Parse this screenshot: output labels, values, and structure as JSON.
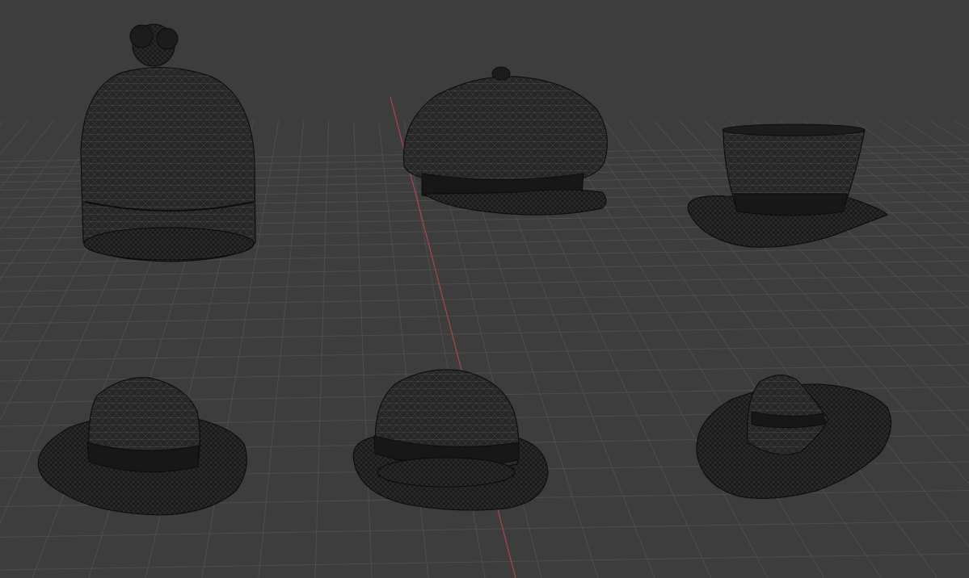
{
  "viewport": {
    "background": "#3d3d3d",
    "grid_color": "#4e4e4e",
    "x_axis_color": "#a9484e",
    "mesh_color": "#262626",
    "wire_color": "#4a4a4a",
    "shading": "wireframe"
  },
  "objects": [
    {
      "name": "beanie-hat",
      "kind": "beanie with pom-pom"
    },
    {
      "name": "newsboy-cap",
      "kind": "newsboy cap"
    },
    {
      "name": "top-hat",
      "kind": "top hat"
    },
    {
      "name": "fedora-hat",
      "kind": "fedora"
    },
    {
      "name": "bowler-hat",
      "kind": "bowler hat"
    },
    {
      "name": "wide-brim-hat",
      "kind": "wide-brim hat"
    }
  ]
}
